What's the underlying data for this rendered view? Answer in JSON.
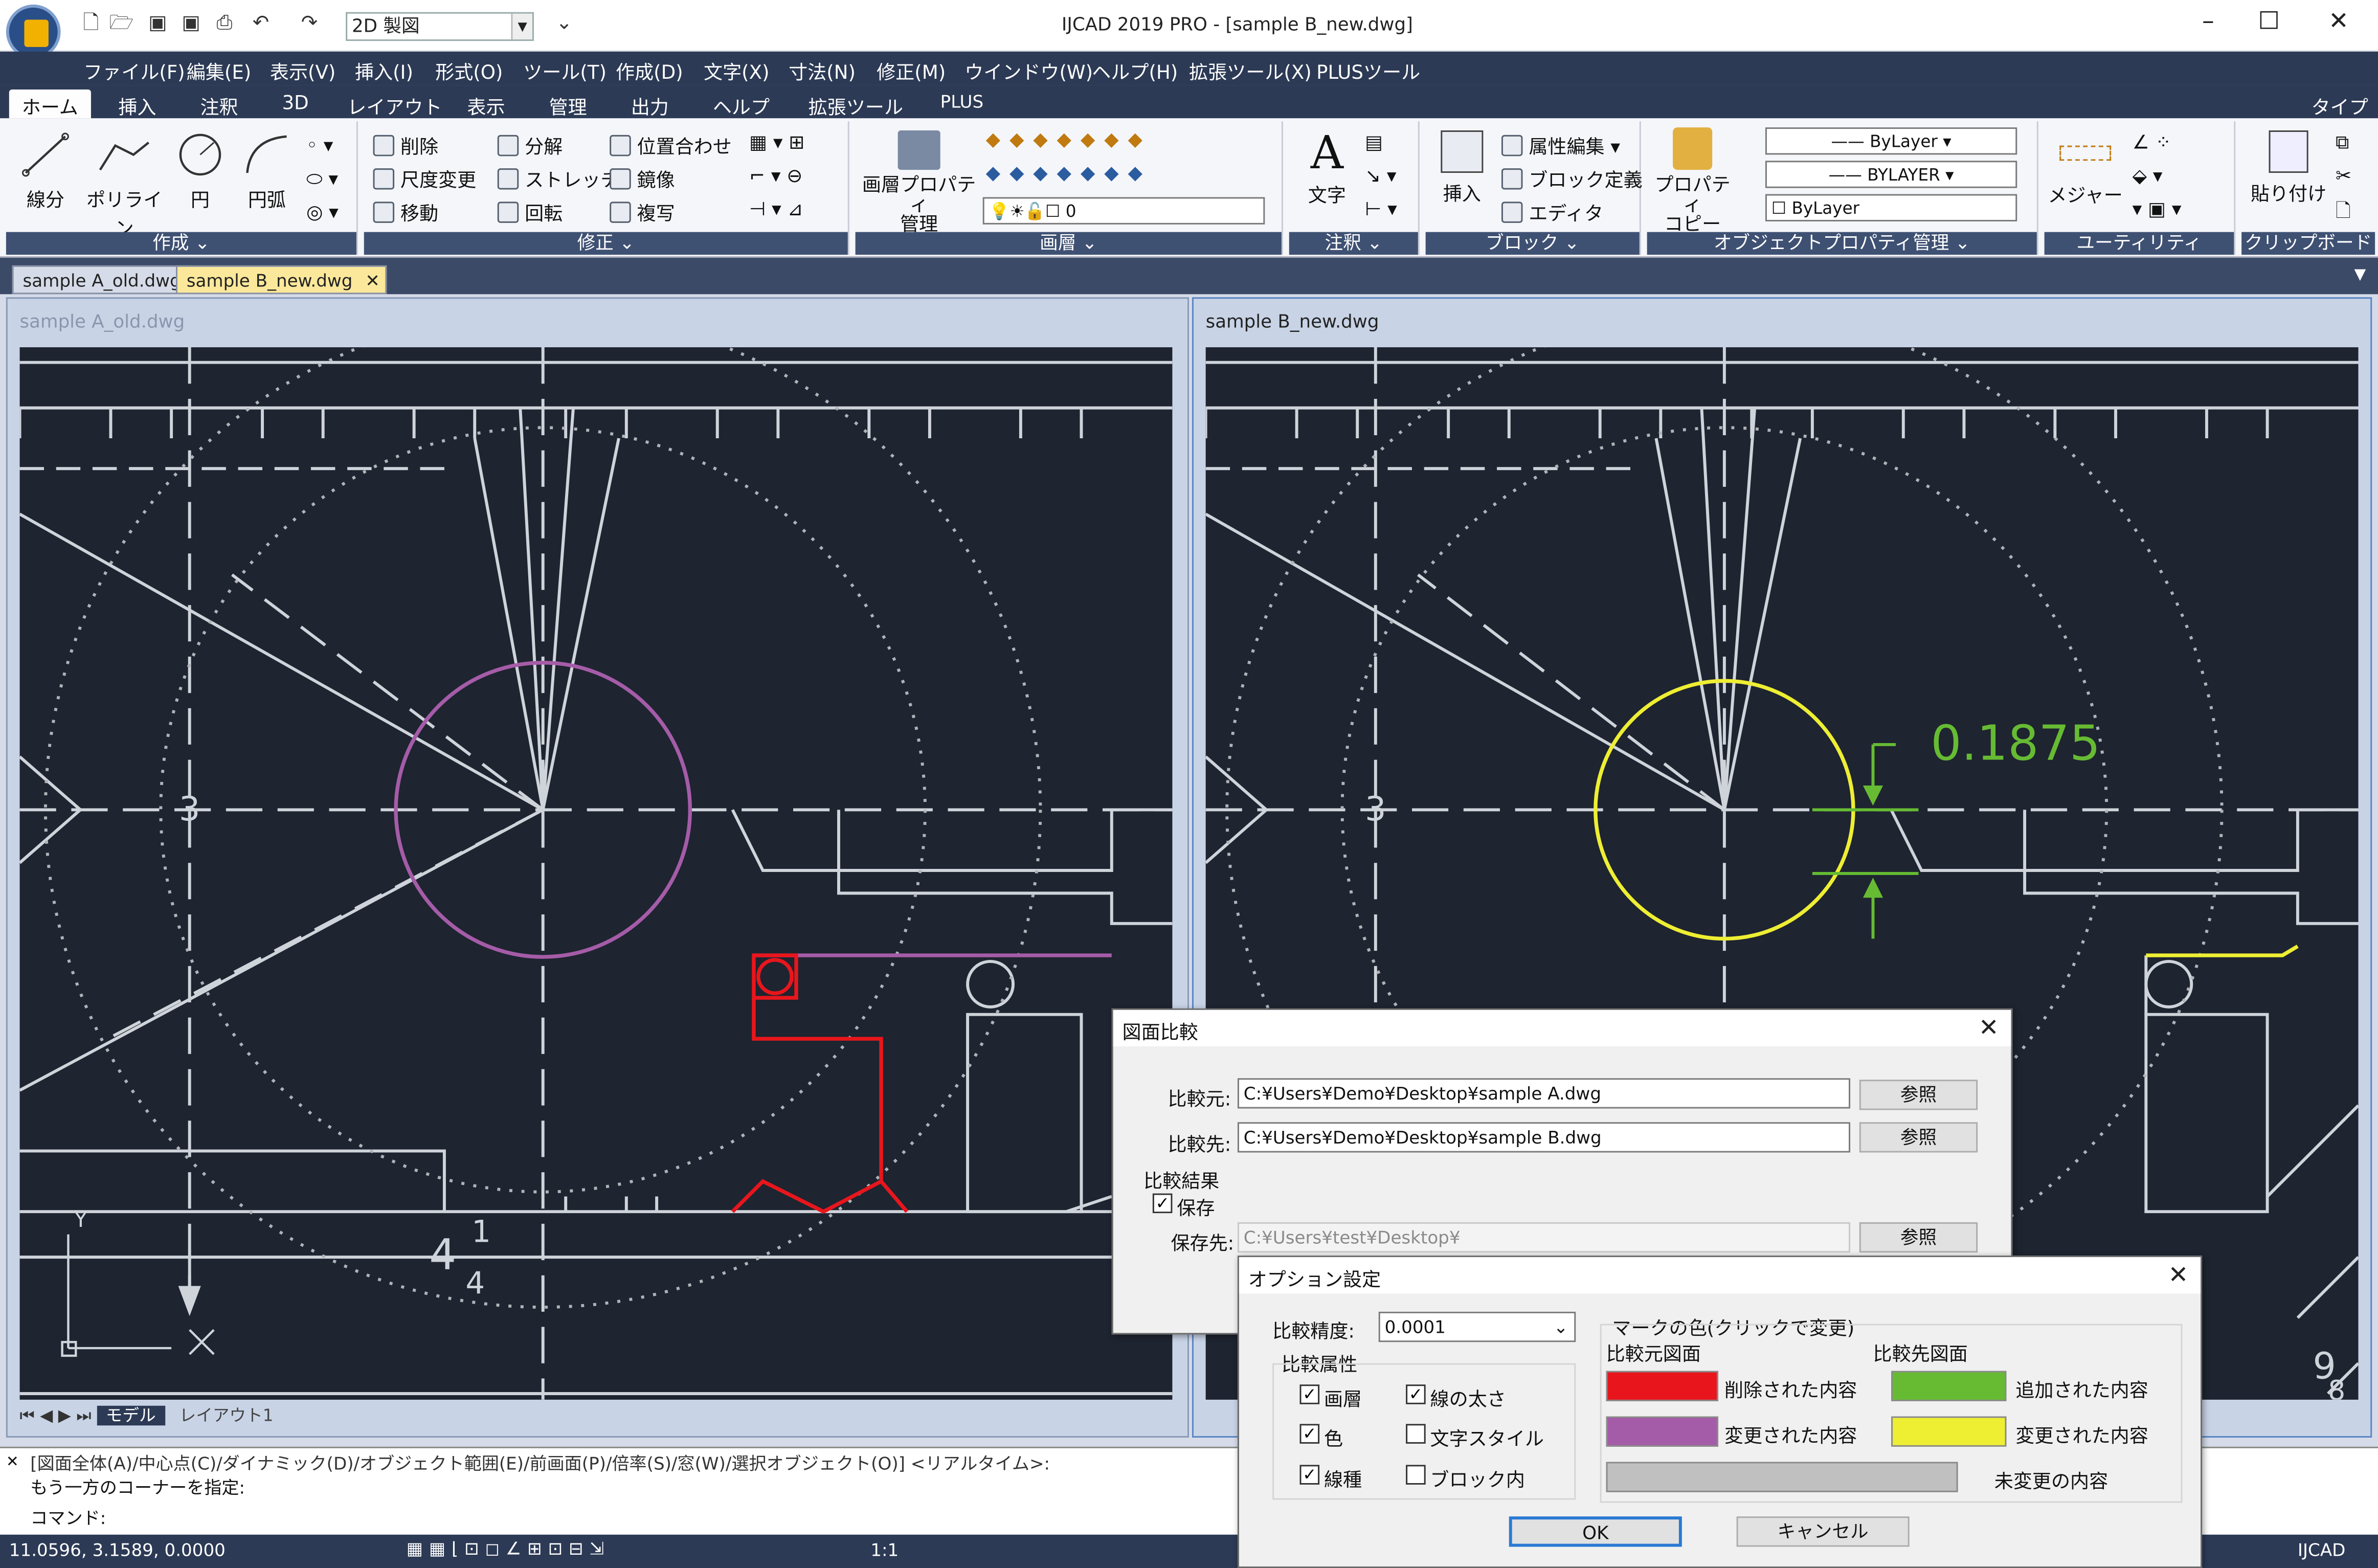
{
  "app": {
    "title": "IJCAD 2019 PRO - [sample B_new.dwg]",
    "workspace": "2D 製図",
    "window_controls": [
      "–",
      "☐",
      "✕"
    ]
  },
  "menu": [
    "ファイル(F)",
    "編集(E)",
    "表示(V)",
    "挿入(I)",
    "形式(O)",
    "ツール(T)",
    "作成(D)",
    "文字(X)",
    "寸法(N)",
    "修正(M)",
    "ウインドウ(W)",
    "ヘルプ(H)",
    "拡張ツール(X)",
    "PLUSツール"
  ],
  "ribbon_tabs": [
    "ホーム",
    "挿入",
    "注釈",
    "3D",
    "レイアウト",
    "表示",
    "管理",
    "出力",
    "ヘルプ",
    "拡張ツール",
    "PLUS"
  ],
  "ribbon_right": "タイプ",
  "panels": {
    "create": {
      "label": "作成 ⌄",
      "buttons": [
        "線分",
        "ポリライン",
        "円",
        "円弧"
      ]
    },
    "modify": {
      "label": "修正 ⌄",
      "buttons": [
        "削除",
        "分解",
        "位置合わせ",
        "尺度変更",
        "ストレッチ",
        "鏡像",
        "移動",
        "回転",
        "複写"
      ]
    },
    "layer": {
      "label": "画層 ⌄",
      "buttons": [
        "画層プロパティ",
        "管理"
      ],
      "current": "0"
    },
    "annot": {
      "label": "注釈 ⌄",
      "buttons": [
        "文字"
      ]
    },
    "block": {
      "label": "ブロック ⌄",
      "buttons": [
        "挿入",
        "属性編集",
        "ブロック定義",
        "エディタ"
      ]
    },
    "props": {
      "label": "オブジェクトプロパティ管理 ⌄",
      "buttons": [
        "プロパティ",
        "コピー"
      ],
      "values": [
        "ByLayer",
        "BYLAYER",
        "ByLayer"
      ]
    },
    "util": {
      "label": "ユーティリティ",
      "buttons": [
        "メジャー"
      ]
    },
    "clip": {
      "label": "クリップボード",
      "buttons": [
        "貼り付け"
      ]
    }
  },
  "doc_tabs": [
    "sample A_old.dwg",
    "sample B_new.dwg"
  ],
  "viewports": {
    "left_title": "sample A_old.dwg",
    "right_title": "sample B_new.dwg",
    "model_tabs": [
      "モデル",
      "レイアウト1"
    ]
  },
  "drawing": {
    "dimension_text": "0.1875",
    "label_3": "3",
    "label_4": "4",
    "frac_top": "1",
    "frac_bottom": "4",
    "label_9": "9",
    "label_8": "8",
    "axis_y": "Y",
    "axis_x": "X"
  },
  "command": {
    "line1": "[図面全体(A)/中心点(C)/ダイナミック(D)/オブジェクト範囲(E)/前画面(P)/倍率(S)/窓(W)/選択オブジェクト(O)] <リアルタイム>:",
    "line2": "もう一方のコーナーを指定:",
    "line3": "コマンド:"
  },
  "status": {
    "coords": "11.0596, 3.1589, 0.0000",
    "scale": "1:1",
    "brand": "IJCAD"
  },
  "compare_dialog": {
    "title": "図面比較",
    "source_label": "比較元:",
    "source_value": "C:¥Users¥Demo¥Desktop¥sample A.dwg",
    "target_label": "比較先:",
    "target_value": "C:¥Users¥Demo¥Desktop¥sample B.dwg",
    "browse": "参照",
    "result_group": "比較結果",
    "save_label": "保存",
    "save_dest_label": "保存先:",
    "save_dest_value": "C:¥Users¥test¥Desktop¥",
    "save_checked": true
  },
  "options_dialog": {
    "title": "オプション設定",
    "precision_label": "比較精度:",
    "precision_value": "0.0001",
    "attr_group": "比較属性",
    "attrs": [
      {
        "label": "画層",
        "checked": true
      },
      {
        "label": "線の太さ",
        "checked": true
      },
      {
        "label": "色",
        "checked": true
      },
      {
        "label": "文字スタイル",
        "checked": false
      },
      {
        "label": "線種",
        "checked": true
      },
      {
        "label": "ブロック内",
        "checked": false
      }
    ],
    "mark_group": "マークの色(クリックで変更)",
    "source_head": "比較元図面",
    "target_head": "比較先図面",
    "marks": {
      "deleted": {
        "label": "削除された内容",
        "color": "#e8161c"
      },
      "added": {
        "label": "追加された内容",
        "color": "#66bb33"
      },
      "changed_src": {
        "label": "変更された内容",
        "color": "#a55ca8"
      },
      "changed_dst": {
        "label": "変更された内容",
        "color": "#eeee33"
      },
      "unchanged": {
        "label": "未変更の内容",
        "color": "#c0c0c0"
      }
    },
    "ok": "OK",
    "cancel": "キャンセル"
  }
}
